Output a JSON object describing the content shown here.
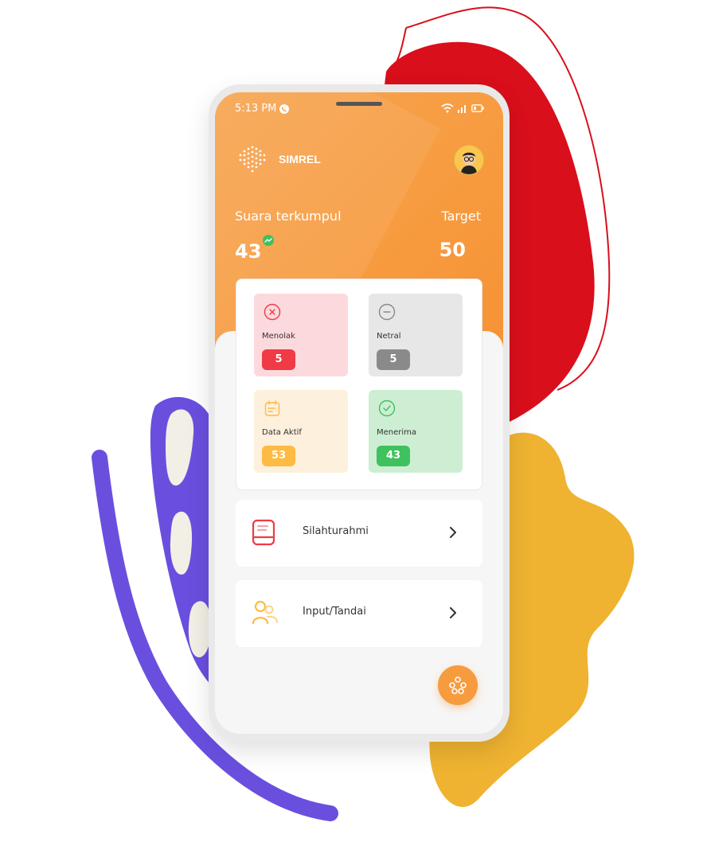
{
  "status_bar": {
    "time": "5:13 PM"
  },
  "app": {
    "name": "SIMREL"
  },
  "summary": {
    "collected_label": "Suara terkumpul",
    "collected_value": "43",
    "target_label": "Target",
    "target_value": "50"
  },
  "stats": [
    {
      "label": "Menolak",
      "value": "5",
      "color": "#f03a45",
      "bg": "#fcd9dc"
    },
    {
      "label": "Netral",
      "value": "5",
      "color": "#8a8a8a",
      "bg": "#e7e7e7"
    },
    {
      "label": "Data Aktif",
      "value": "53",
      "color": "#fdbb44",
      "bg": "#fdf0dc"
    },
    {
      "label": "Menerima",
      "value": "43",
      "color": "#3fc15d",
      "bg": "#cdeed3"
    }
  ],
  "menu": [
    {
      "label": "Silahturahmi",
      "icon": "book-icon"
    },
    {
      "label": "Input/Tandai",
      "icon": "users-icon"
    }
  ],
  "fab": {
    "icon": "group-icon"
  },
  "colors": {
    "primary": "#f79b3f",
    "blob_red": "#d90f1b",
    "blob_yellow": "#efb331",
    "blob_purple": "#6a4fdf"
  }
}
